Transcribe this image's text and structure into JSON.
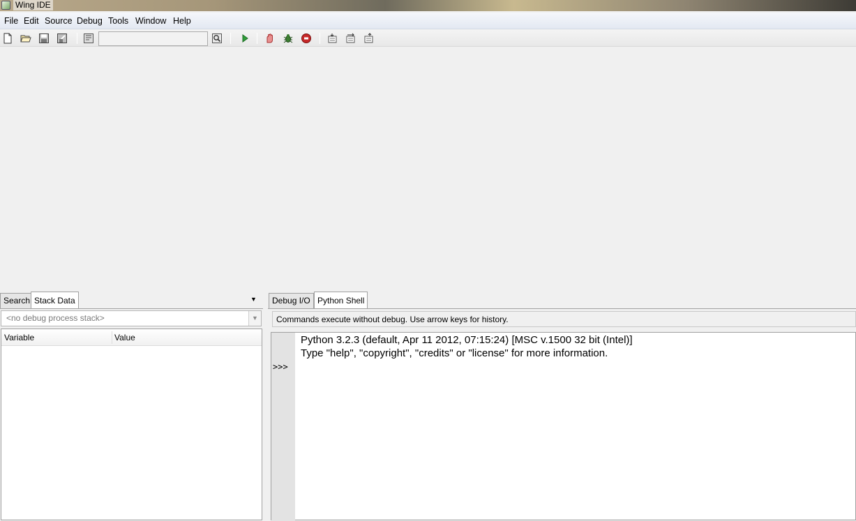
{
  "window": {
    "title": "Wing IDE"
  },
  "menubar": {
    "items": [
      {
        "label": "File"
      },
      {
        "label": "Edit"
      },
      {
        "label": "Source"
      },
      {
        "label": "Debug"
      },
      {
        "label": "Tools"
      },
      {
        "label": "Window"
      },
      {
        "label": "Help"
      }
    ]
  },
  "toolbar": {
    "icons": [
      "new-file-icon",
      "open-file-icon",
      "save-icon",
      "save-all-icon",
      "print-icon",
      "search-icon",
      "run-icon",
      "stop-hand-icon",
      "debug-bug-icon",
      "stop-debug-icon",
      "step-into-icon",
      "step-over-icon",
      "step-out-icon"
    ],
    "search_value": ""
  },
  "left_panel": {
    "tabs": [
      {
        "label": "Search",
        "active": false
      },
      {
        "label": "Stack Data",
        "active": true
      }
    ],
    "stack_placeholder": "<no debug process stack>",
    "columns": [
      "Variable",
      "Value"
    ]
  },
  "right_panel": {
    "tabs": [
      {
        "label": "Debug I/O",
        "active": false
      },
      {
        "label": "Python Shell",
        "active": true
      }
    ],
    "info_text": "Commands execute without debug.  Use arrow keys for history.",
    "shell_lines": [
      "Python 3.2.3 (default, Apr 11 2012, 07:15:24) [MSC v.1500 32 bit (Intel)]",
      "Type \"help\", \"copyright\", \"credits\" or \"license\" for more information."
    ],
    "prompt": ">>>"
  }
}
